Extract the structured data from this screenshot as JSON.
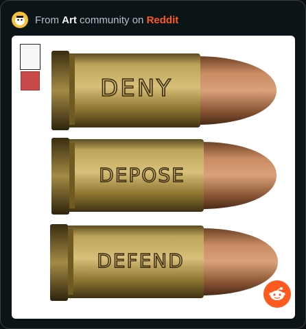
{
  "header": {
    "prefix": "From ",
    "community": "Art",
    "middle": " community on ",
    "platform": "Reddit",
    "avatar_icon": "snoo-avatar-icon"
  },
  "image": {
    "bullet_words": [
      "DENY",
      "DEPOSE",
      "DEFEND"
    ]
  },
  "colors": {
    "brand": "#ff5a1f",
    "background": "#0b1416",
    "text": "#b7c0c6"
  }
}
